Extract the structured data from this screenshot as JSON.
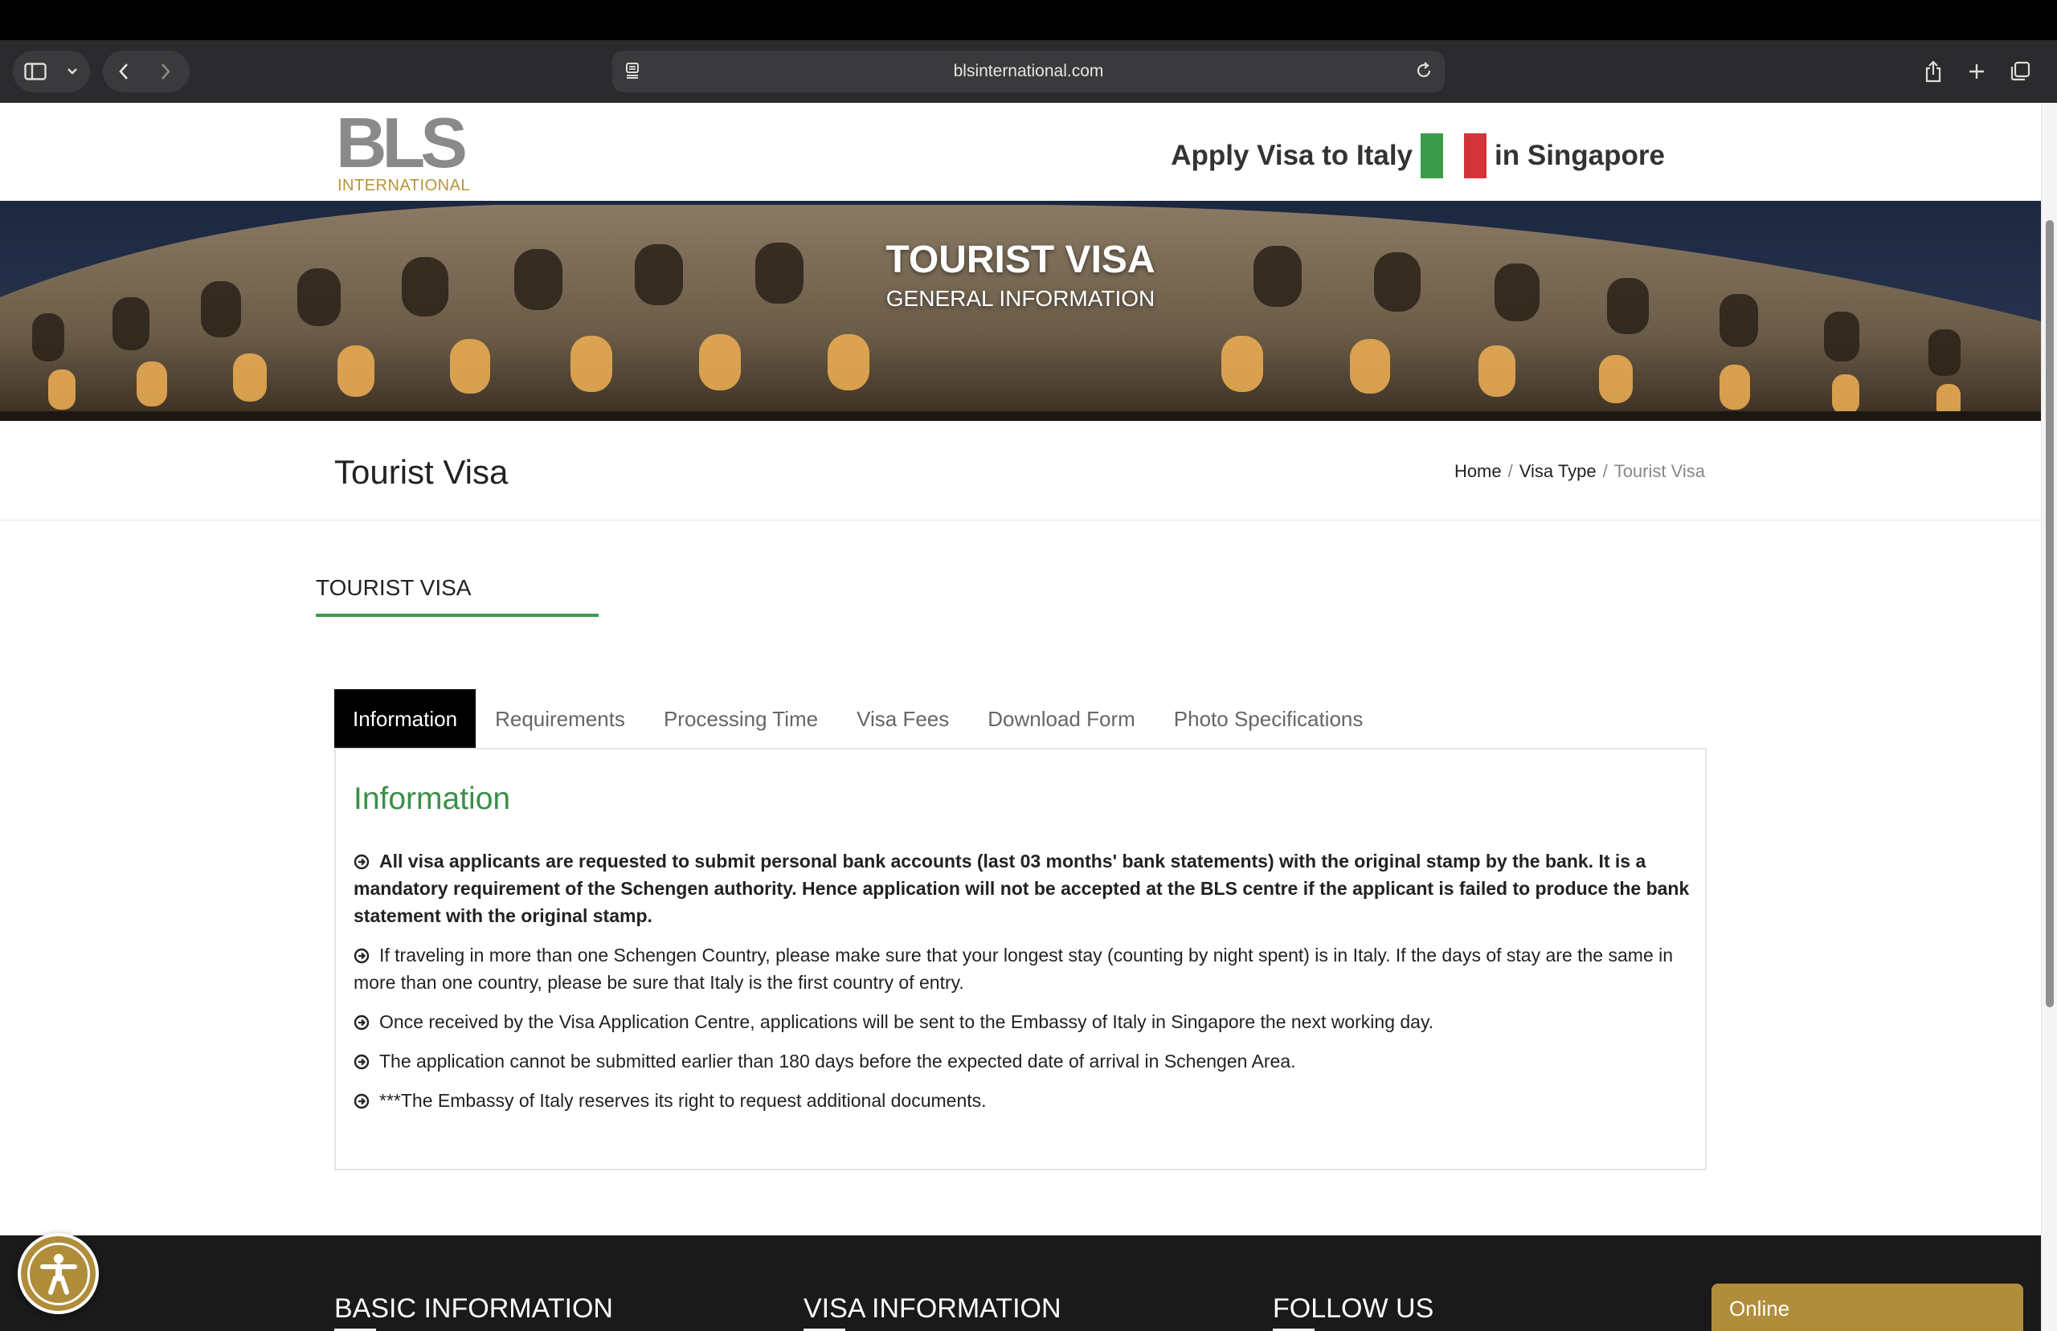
{
  "browser": {
    "url": "blsinternational.com"
  },
  "header": {
    "logo_text": "BLS",
    "logo_sub": "INTERNATIONAL",
    "title_pre": "Apply Visa to Italy",
    "title_post": "in Singapore",
    "flag_colors": [
      "#3b9b4a",
      "#ffffff",
      "#d2343a"
    ]
  },
  "hero": {
    "title": "TOURIST VISA",
    "subtitle": "GENERAL INFORMATION"
  },
  "titlebar": {
    "title": "Tourist Visa",
    "breadcrumb": {
      "home": "Home",
      "visa_type": "Visa Type",
      "current": "Tourist Visa",
      "separator": "/"
    }
  },
  "section": {
    "heading": "TOURIST VISA",
    "accent": "#3a9a4a"
  },
  "tabs": [
    {
      "label": "Information",
      "active": true
    },
    {
      "label": "Requirements",
      "active": false
    },
    {
      "label": "Processing Time",
      "active": false
    },
    {
      "label": "Visa Fees",
      "active": false
    },
    {
      "label": "Download Form",
      "active": false
    },
    {
      "label": "Photo Specifications",
      "active": false
    }
  ],
  "panel": {
    "title": "Information",
    "items": [
      {
        "text": "All visa applicants are requested to submit personal bank accounts (last 03 months' bank statements) with the original stamp by the bank. It is a mandatory requirement of the Schengen authority. Hence application will not be accepted at the BLS centre if the applicant is failed to produce the bank statement with the original stamp.",
        "bold": true
      },
      {
        "text": "If traveling in more than one Schengen Country, please make sure that your longest stay (counting by night spent) is in Italy. If the days of stay are the same in more than one country, please be sure that Italy is the first country of entry.",
        "bold": false
      },
      {
        "text": "Once received by the Visa Application Centre, applications will be sent to the Embassy of Italy in Singapore the next working day.",
        "bold": false
      },
      {
        "text": "The application cannot be submitted earlier than 180 days before the expected date of arrival in Schengen Area.",
        "bold": false
      },
      {
        "text": "***The Embassy of Italy reserves its right to request additional documents.",
        "bold": false
      }
    ]
  },
  "footer": {
    "col1": "BASIC INFORMATION",
    "col2": "VISA INFORMATION",
    "col3": "FOLLOW US"
  },
  "widgets": {
    "chat_label": "Online",
    "accessibility_icon": "accessibility-icon"
  },
  "colors": {
    "brand_gold": "#b08d3b",
    "accent_green": "#3a8f48"
  }
}
